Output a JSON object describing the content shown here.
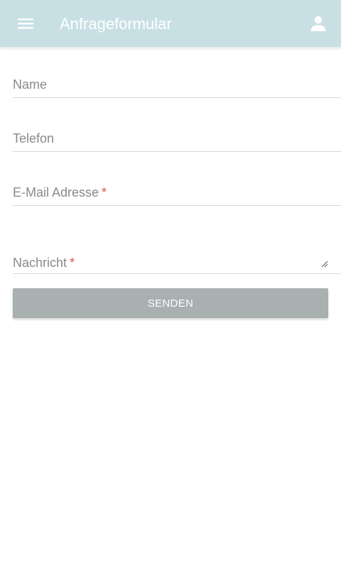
{
  "appbar": {
    "title": "Anfrageformular",
    "menu_icon": "hamburger-menu-icon",
    "user_icon": "user-account-icon",
    "background": "#c8e0e4"
  },
  "form": {
    "name": {
      "label": "Name",
      "value": ""
    },
    "phone": {
      "label": "Telefon",
      "value": ""
    },
    "email": {
      "label": "E-Mail Adresse",
      "required_mark": "*",
      "value": ""
    },
    "message": {
      "label": "Nachricht",
      "required_mark": "*",
      "value": ""
    },
    "submit_label": "SENDEN",
    "submit_color": "#a8b0b0",
    "required_color": "#e05555"
  }
}
